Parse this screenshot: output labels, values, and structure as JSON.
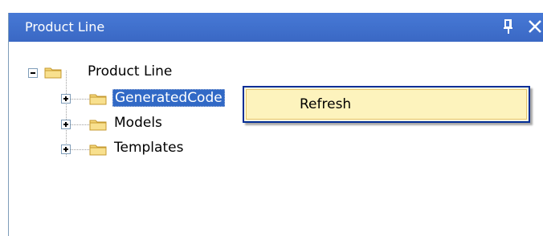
{
  "panel": {
    "title": "Product Line",
    "pin_icon": "pin-icon",
    "close_icon": "close-icon"
  },
  "tree": {
    "root": {
      "label": "Product Line",
      "expanded": true,
      "icon": "folder-icon"
    },
    "children": [
      {
        "label": "GeneratedCode",
        "selected": true,
        "expanded": false,
        "icon": "folder-icon"
      },
      {
        "label": "Models",
        "selected": false,
        "expanded": false,
        "icon": "folder-icon"
      },
      {
        "label": "Templates",
        "selected": false,
        "expanded": false,
        "icon": "folder-icon"
      }
    ]
  },
  "context_menu": {
    "items": [
      {
        "label": "Refresh"
      }
    ]
  },
  "colors": {
    "titlebar": "#4779d6",
    "selection": "#3169c6",
    "menu_bg": "#fcfbe3",
    "menu_hover": "#fdf3bd",
    "menu_border": "#002d96"
  }
}
